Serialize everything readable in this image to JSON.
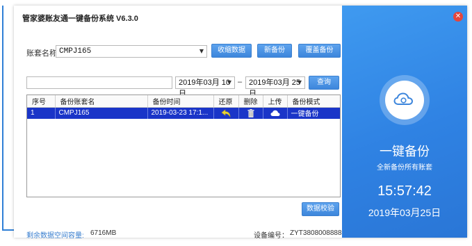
{
  "window": {
    "title": "管家婆账友通一键备份系统 V6.3.0"
  },
  "account": {
    "label": "账套名称",
    "selected": "CMPJ165"
  },
  "actions": {
    "collect": "收缩数据",
    "new_backup": "新备份",
    "overwrite": "覆盖备份"
  },
  "filter": {
    "search_value": "",
    "date_from": "2019年03月 10日",
    "separator": "–",
    "date_to": "2019年03月 25日",
    "query": "查询"
  },
  "table": {
    "headers": [
      "序号",
      "备份账套名",
      "备份时间",
      "还原",
      "删除",
      "上传",
      "备份模式"
    ],
    "rows": [
      {
        "index": "1",
        "name": "CMPJ165",
        "time": "2019-03-23 17:1...",
        "mode": "一键备份"
      }
    ]
  },
  "verify_button": "数据校验",
  "footer": {
    "space_label": "剩余数据空间容量:",
    "space_value": "6716MB",
    "device_label": "设备编号：",
    "device_value": "ZYT3808008888"
  },
  "side": {
    "title": "一键备份",
    "subtitle": "全新备份所有账套",
    "time": "15:57:42",
    "date": "2019年03月25日"
  },
  "icons": {
    "restore": "undo-arrow-icon",
    "delete": "trash-icon",
    "upload": "cloud-icon",
    "side": "cloud-icon",
    "close": "close-icon"
  },
  "colors": {
    "accent": "#3d86dc",
    "row_selected": "#1a35c8",
    "panel": "#2f82e3",
    "close": "#e5453b"
  }
}
